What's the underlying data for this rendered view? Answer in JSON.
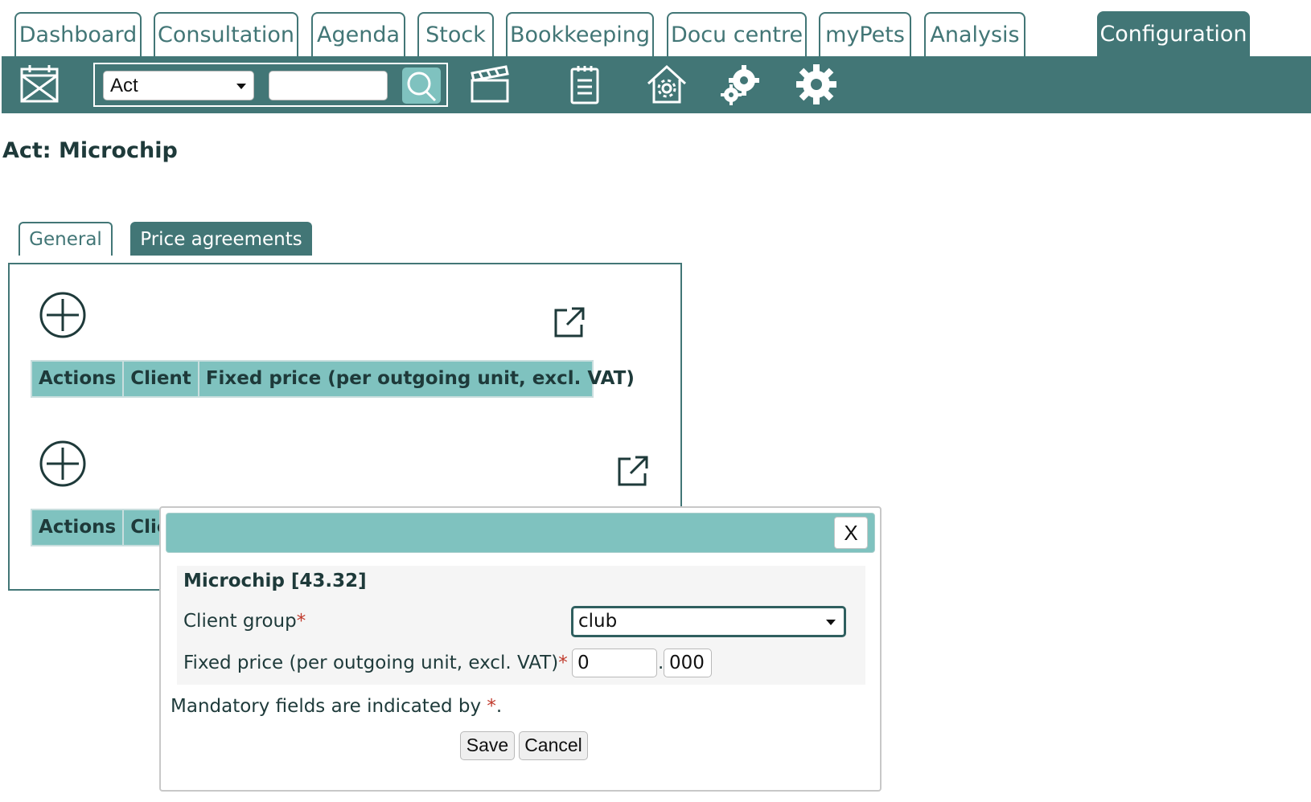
{
  "nav": {
    "tabs": [
      {
        "label": "Dashboard"
      },
      {
        "label": "Consultation"
      },
      {
        "label": "Agenda"
      },
      {
        "label": "Stock"
      },
      {
        "label": "Bookkeeping"
      },
      {
        "label": "Docu centre"
      },
      {
        "label": "myPets"
      },
      {
        "label": "Analysis"
      },
      {
        "label": "Configuration",
        "active": true
      }
    ]
  },
  "toolbar": {
    "search_type": "Act",
    "search_value": "",
    "icons": [
      "calendar-close-icon",
      "search-icon",
      "clapperboard-icon",
      "clipboard-icon",
      "house-gear-icon",
      "gears-icon",
      "gear-icon"
    ]
  },
  "page": {
    "title": "Act: Microchip",
    "tabs": [
      {
        "label": "General"
      },
      {
        "label": "Price agreements",
        "active": true
      }
    ]
  },
  "grids": [
    {
      "headers": [
        "Actions",
        "Client",
        "Fixed price (per outgoing unit, excl. VAT)"
      ]
    },
    {
      "headers": [
        "Actions",
        "Client group"
      ]
    }
  ],
  "dialog": {
    "close_label": "X",
    "heading": "Microchip [43.32]",
    "client_group_label": "Client group",
    "client_group_value": "club",
    "fixed_price_label": "Fixed price (per outgoing unit, excl. VAT)",
    "price_integer": "0",
    "price_decimal_sep": ".",
    "price_fraction": "000",
    "required_marker": "*",
    "mandatory_note": "Mandatory fields are indicated by",
    "mandatory_note_end": ".",
    "save_label": "Save",
    "cancel_label": "Cancel"
  },
  "colors": {
    "primary": "#427676",
    "accent": "#7fc2bf",
    "required": "#c0392b"
  }
}
